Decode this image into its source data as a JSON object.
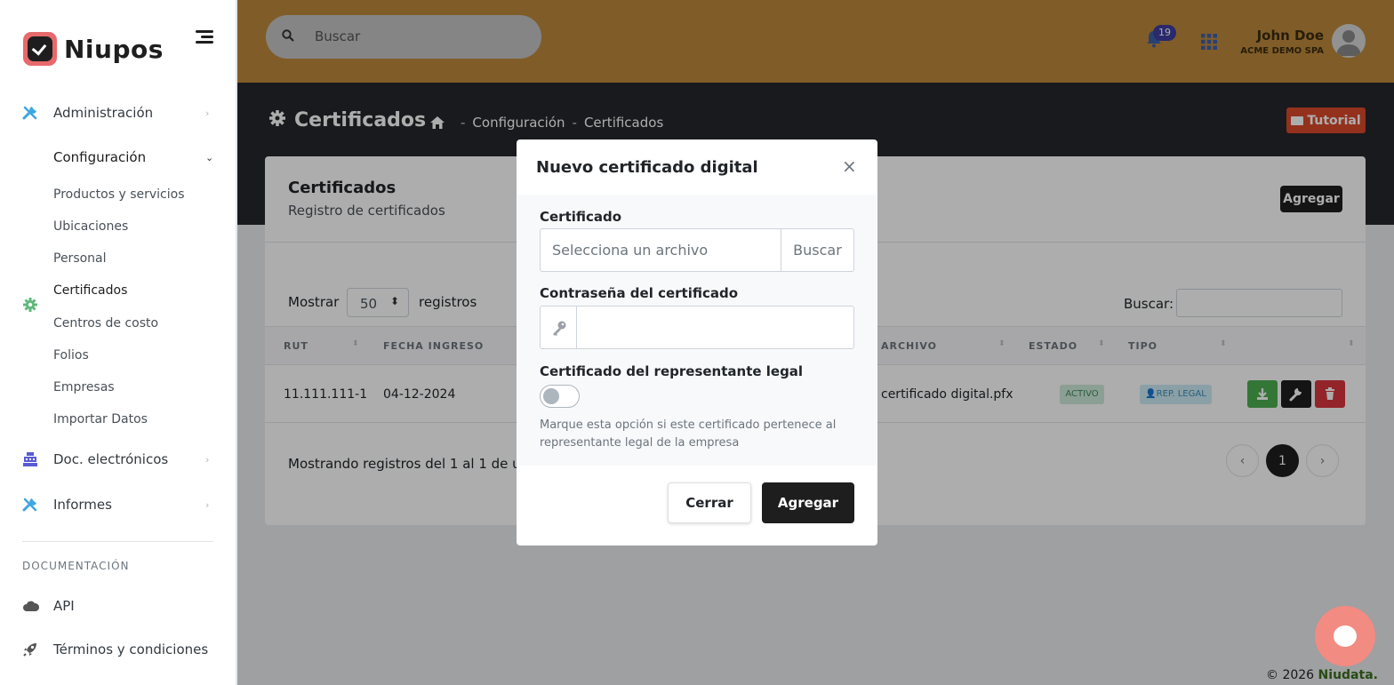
{
  "brand": {
    "name": "Niupos"
  },
  "sidebar": {
    "items": [
      {
        "label": "Administración",
        "icon": "tools-icon"
      },
      {
        "label": "Configuración",
        "icon": "gear-icon"
      },
      {
        "label": "Doc. electrónicos",
        "icon": "cash-register-icon"
      },
      {
        "label": "Informes",
        "icon": "tools-icon"
      }
    ],
    "sub_items": [
      "Productos y servicios",
      "Ubicaciones",
      "Personal",
      "Certificados",
      "Centros de costo",
      "Folios",
      "Empresas",
      "Importar Datos"
    ],
    "section_title": "DOCUMENTACIÓN",
    "doc_items": [
      {
        "label": "API",
        "icon": "cloud-icon"
      },
      {
        "label": "Términos y condiciones",
        "icon": "rocket-icon"
      }
    ]
  },
  "header": {
    "search_placeholder": "Buscar",
    "notifications": "19",
    "user_name": "John Doe",
    "user_company": "ACME DEMO SPA"
  },
  "page": {
    "title": "Certificados",
    "breadcrumb": [
      "Configuración",
      "Certificados"
    ],
    "tutorial": "Tutorial"
  },
  "card": {
    "title": "Certificados",
    "subtitle": "Registro de certificados",
    "add": "Agregar",
    "show_label": "Mostrar",
    "show_value": "50",
    "records_label": "registros",
    "search_label": "Buscar:",
    "columns": [
      "RUT",
      "FECHA INGRESO",
      "ARCHIVO",
      "ESTADO",
      "TIPO"
    ],
    "row": {
      "rut": "11.111.111-1",
      "fecha": "04-12-2024",
      "archivo": "certificado digital.pfx",
      "estado": "ACTIVO",
      "tipo": "REP. LEGAL"
    },
    "info": "Mostrando registros del 1 al 1 de un t",
    "page": "1"
  },
  "modal": {
    "title": "Nuevo certificado digital",
    "close": "×",
    "cert_label": "Certificado",
    "file_placeholder": "Selecciona un archivo",
    "file_button": "Buscar",
    "password_label": "Contraseña del certificado",
    "rep_label": "Certificado del representante legal",
    "help": "Marque esta opción si este certificado pertenece al representante legal de la empresa",
    "btn_close": "Cerrar",
    "btn_add": "Agregar"
  },
  "footer": {
    "copy": "© 2026",
    "brand": "Niudata."
  },
  "colors": {
    "accent": "#bd8a3c",
    "dark": "#1e1e1e",
    "tutorial": "#d9492b",
    "active_badge": "#cfeadb",
    "rep_badge": "#cdeaf5",
    "download": "#4caf50",
    "delete": "#d9363e",
    "chat": "#f28b82"
  }
}
